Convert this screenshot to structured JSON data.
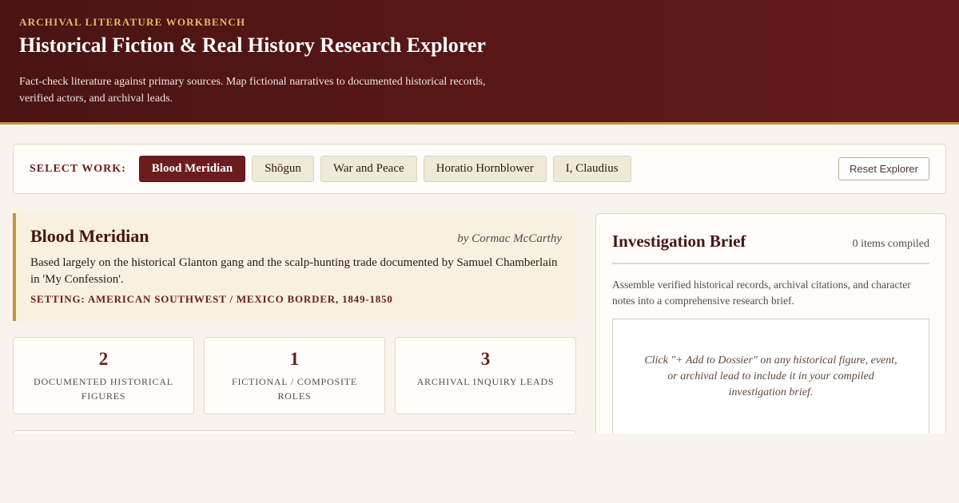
{
  "header": {
    "eyebrow": "ARCHIVAL LITERATURE WORKBENCH",
    "title": "Historical Fiction & Real History Research Explorer",
    "subtitle": "Fact-check literature against primary sources. Map fictional narratives to documented historical records, verified actors, and archival leads."
  },
  "selector": {
    "label": "SELECT WORK:",
    "works": [
      "Blood Meridian",
      "Shōgun",
      "War and Peace",
      "Horatio Hornblower",
      "I, Claudius"
    ],
    "active": "Blood Meridian",
    "reset_label": "Reset Explorer"
  },
  "work": {
    "title": "Blood Meridian",
    "author": "by Cormac McCarthy",
    "description": "Based largely on the historical Glanton gang and the scalp-hunting trade documented by Samuel Chamberlain in 'My Confession'.",
    "setting": "SETTING: AMERICAN SOUTHWEST / MEXICO BORDER, 1849-1850"
  },
  "stats": [
    {
      "value": "2",
      "label": "DOCUMENTED HISTORICAL FIGURES"
    },
    {
      "value": "1",
      "label": "FICTIONAL / COMPOSITE ROLES"
    },
    {
      "value": "3",
      "label": "ARCHIVAL INQUIRY LEADS"
    }
  ],
  "brief": {
    "title": "Investigation Brief",
    "count": "0 items compiled",
    "description": "Assemble verified historical records, archival citations, and character notes into a comprehensive research brief.",
    "empty_text": "Click \"+ Add to Dossier\" on any historical figure, event, or archival lead to include it in your compiled investigation brief."
  },
  "colors": {
    "accent": "#6b1d1d",
    "gold": "#c9933a",
    "header_bg": "#5a1818",
    "page_bg": "#f8f4ed"
  }
}
